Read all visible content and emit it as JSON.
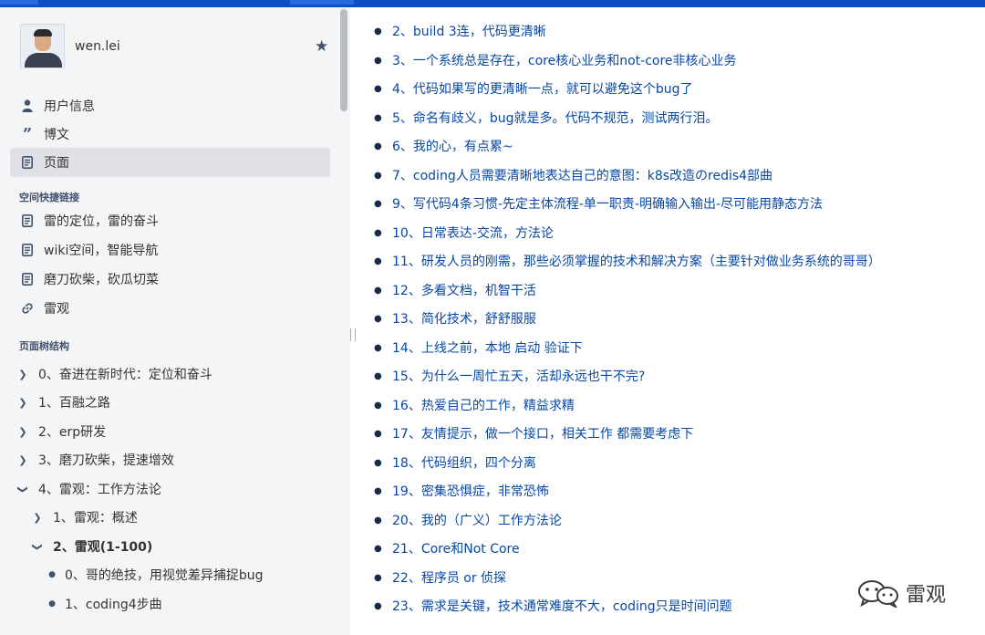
{
  "user": {
    "name": "wen.lei"
  },
  "nav": [
    {
      "label": "用户信息",
      "icon": "person-icon"
    },
    {
      "label": "博文",
      "icon": "quote-icon"
    },
    {
      "label": "页面",
      "icon": "page-icon",
      "active": true
    }
  ],
  "shortcuts": {
    "title": "空间快捷链接",
    "items": [
      {
        "label": "雷的定位，雷的奋斗",
        "icon": "page-icon"
      },
      {
        "label": "wiki空间，智能导航",
        "icon": "page-icon"
      },
      {
        "label": "磨刀砍柴，砍瓜切菜",
        "icon": "page-icon"
      },
      {
        "label": "雷观",
        "icon": "link-icon"
      }
    ]
  },
  "tree": {
    "title": "页面树结构",
    "items": [
      {
        "label": "0、奋进在新时代：定位和奋斗",
        "state": "collapsed"
      },
      {
        "label": "1、百融之路",
        "state": "collapsed"
      },
      {
        "label": "2、erp研发",
        "state": "collapsed"
      },
      {
        "label": "3、磨刀砍柴，提速增效",
        "state": "collapsed"
      },
      {
        "label": "4、雷观：工作方法论",
        "state": "expanded"
      },
      {
        "label": "1、雷观：概述",
        "state": "collapsed"
      },
      {
        "label": "2、雷观(1-100)",
        "state": "expanded"
      },
      {
        "label": "0、哥的绝技，用视觉差异捕捉bug",
        "state": "leaf"
      },
      {
        "label": "1、coding4步曲",
        "state": "leaf"
      }
    ]
  },
  "toc": [
    "2、build 3连，代码更清晰",
    "3、一个系统总是存在，core核心业务和not-core非核心业务",
    "4、代码如果写的更清晰一点，就可以避免这个bug了",
    "5、命名有歧义，bug就是多。代码不规范，测试两行泪。",
    "6、我的心，有点累~",
    "7、coding人员需要清晰地表达自己的意图：k8s改造のredis4部曲",
    "9、写代码4条习惯-先定主体流程-单一职责-明确输入输出-尽可能用静态方法",
    "10、日常表达-交流，方法论",
    "11、研发人员的刚需，那些必须掌握的技术和解决方案（主要针对做业务系统的哥哥）",
    "12、多看文档，机智干活",
    "13、简化技术，舒舒服服",
    "14、上线之前，本地 启动 验证下",
    "15、为什么一周忙五天，活却永远也干不完?",
    "16、热爱自己的工作，精益求精",
    "17、友情提示，做一个接口，相关工作 都需要考虑下",
    "18、代码组织，四个分离",
    "19、密集恐惧症，非常恐怖",
    "20、我的（广义）工作方法论",
    "21、Core和Not Core",
    "22、程序员 or 侦探",
    "23、需求是关键，技术通常难度不大，coding只是时间问题"
  ],
  "watermark": {
    "text": "雷观",
    "icon": "wechat-icon"
  },
  "colors": {
    "topbar": "#0b4fc2",
    "link": "#0747a6",
    "sidebar_bg": "#f4f5f7"
  }
}
